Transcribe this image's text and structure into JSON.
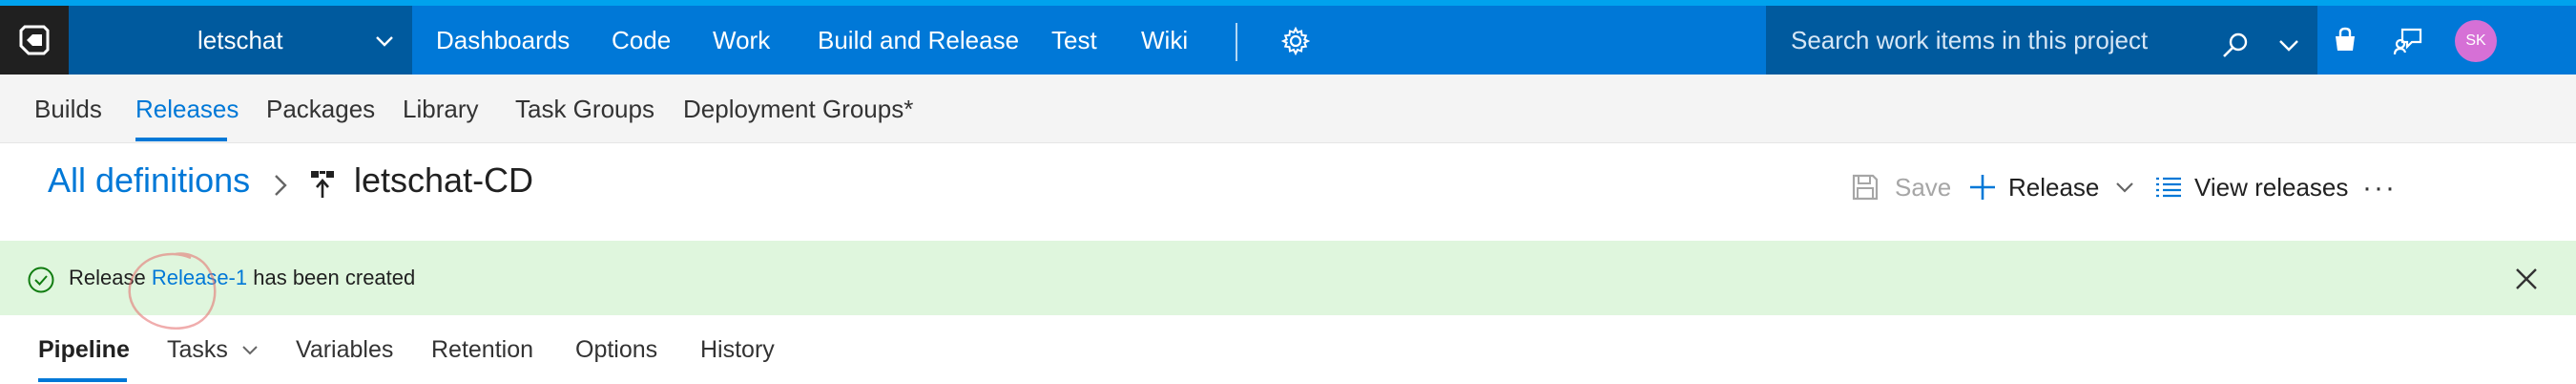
{
  "topnav": {
    "project_name": "letschat",
    "items": [
      {
        "label": "Dashboards"
      },
      {
        "label": "Code"
      },
      {
        "label": "Work"
      },
      {
        "label": "Build and Release"
      },
      {
        "label": "Test"
      },
      {
        "label": "Wiki"
      }
    ],
    "search_placeholder": "Search work items in this project",
    "avatar_initials": "SK",
    "avatar_color": "#d670d6",
    "icons": [
      "vsts-logo-icon",
      "chevron-down-icon",
      "gear-icon",
      "search-icon",
      "marketplace-bag-icon",
      "feedback-icon"
    ]
  },
  "subnav": {
    "items": [
      {
        "label": "Builds"
      },
      {
        "label": "Releases",
        "active": true
      },
      {
        "label": "Packages"
      },
      {
        "label": "Library"
      },
      {
        "label": "Task Groups"
      },
      {
        "label": "Deployment Groups*"
      }
    ]
  },
  "header": {
    "breadcrumb_root": "All definitions",
    "title": "letschat-CD",
    "commands": {
      "save_label": "Save",
      "release_label": "Release",
      "view_releases_label": "View releases",
      "more_label": "···"
    }
  },
  "message": {
    "prefix": "Release ",
    "link_text": "Release-1",
    "suffix": " has been created",
    "status": "success"
  },
  "tabs": [
    {
      "label": "Pipeline",
      "active": true
    },
    {
      "label": "Tasks"
    },
    {
      "label": "Variables"
    },
    {
      "label": "Retention"
    },
    {
      "label": "Options"
    },
    {
      "label": "History"
    }
  ],
  "colors": {
    "accent": "#0078d7",
    "topbar": "#0078d7",
    "topbar_dark": "#005a9e",
    "success_bg": "#dff6dd",
    "success_icon": "#107c10"
  }
}
